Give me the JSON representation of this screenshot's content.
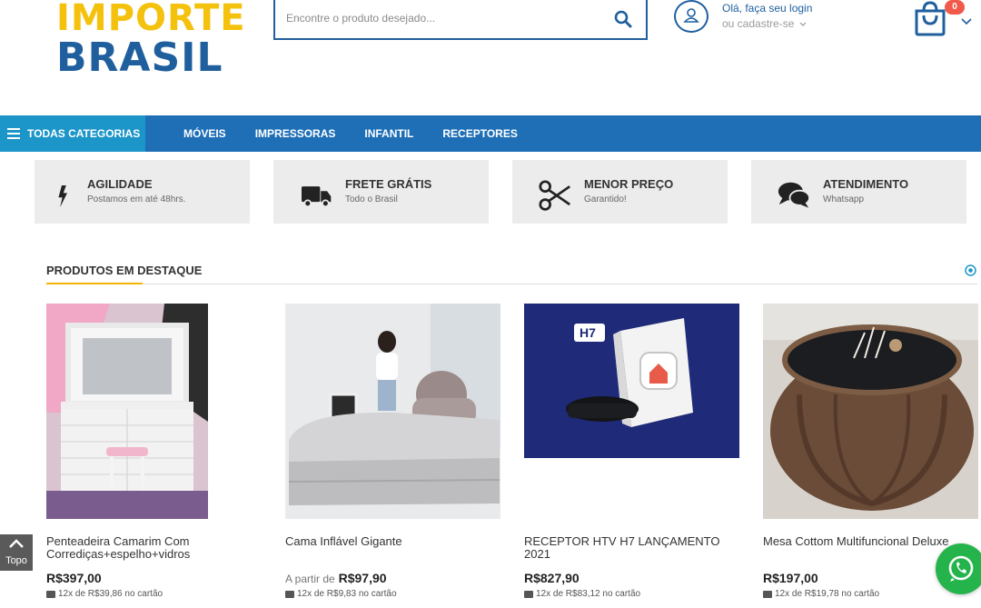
{
  "brand": {
    "line1": "IMPORTE",
    "line2": "BRASIL"
  },
  "search": {
    "placeholder": "Encontre o produto desejado...",
    "value": ""
  },
  "account": {
    "login_text": "Olá, faça seu login",
    "register_text": "ou cadastre-se"
  },
  "cart": {
    "count": "0"
  },
  "nav": {
    "all_categories": "TODAS CATEGORIAS",
    "items": [
      "MÓVEIS",
      "IMPRESSORAS",
      "INFANTIL",
      "RECEPTORES"
    ]
  },
  "benefits": [
    {
      "icon": "lightning-icon",
      "title": "AGILIDADE",
      "subtitle": "Postamos em até 48hrs."
    },
    {
      "icon": "truck-icon",
      "title": "FRETE GRÁTIS",
      "subtitle": "Todo o Brasil"
    },
    {
      "icon": "scissors-icon",
      "title": "MENOR PREÇO",
      "subtitle": "Garantido!"
    },
    {
      "icon": "chat-icon",
      "title": "ATENDIMENTO",
      "subtitle": "Whatsapp"
    }
  ],
  "featured": {
    "title": "PRODUTOS EM DESTAQUE",
    "products": [
      {
        "name": "Penteadeira Camarim Com Corrediças+espelho+vidros",
        "price_prefix": "",
        "price": "R$397,00",
        "installments": "12x de R$39,86 no cartão"
      },
      {
        "name": "Cama Inflável Gigante",
        "price_prefix": "A partir de",
        "price": "R$97,90",
        "installments": "12x de R$9,83 no cartão"
      },
      {
        "name": "RECEPTOR HTV H7 LANÇAMENTO 2021",
        "price_prefix": "",
        "price": "R$827,90",
        "installments": "12x de R$83,12 no cartão",
        "image_badge": "H7"
      },
      {
        "name": "Mesa Cottom Multifuncional Deluxe",
        "price_prefix": "",
        "price": "R$197,00",
        "installments": "12x de R$19,78 no cartão"
      }
    ]
  },
  "floating": {
    "top_label": "Topo"
  },
  "colors": {
    "primary": "#1f6fb7",
    "accent": "#1c95c9",
    "logo_yellow": "#f4c20d",
    "logo_blue": "#1f5f9e",
    "badge_red": "#f15a4a",
    "whatsapp": "#25b34b"
  }
}
